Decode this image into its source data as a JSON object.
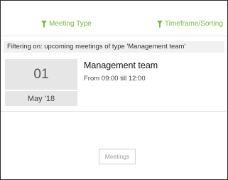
{
  "filters": {
    "meeting_type_label": "Meeting Type",
    "timeframe_label": "Timeframe/Sorting",
    "icon": "filter-funnel-icon",
    "accent_color": "#7ab648"
  },
  "status": {
    "text": "Filtering on: upcoming meetings of type 'Management team'"
  },
  "meetings": [
    {
      "day": "01",
      "month": "May '18",
      "title": "Management team",
      "time": "From 09:00 till 12:00"
    }
  ],
  "footer": {
    "button_label": "Meetings"
  }
}
